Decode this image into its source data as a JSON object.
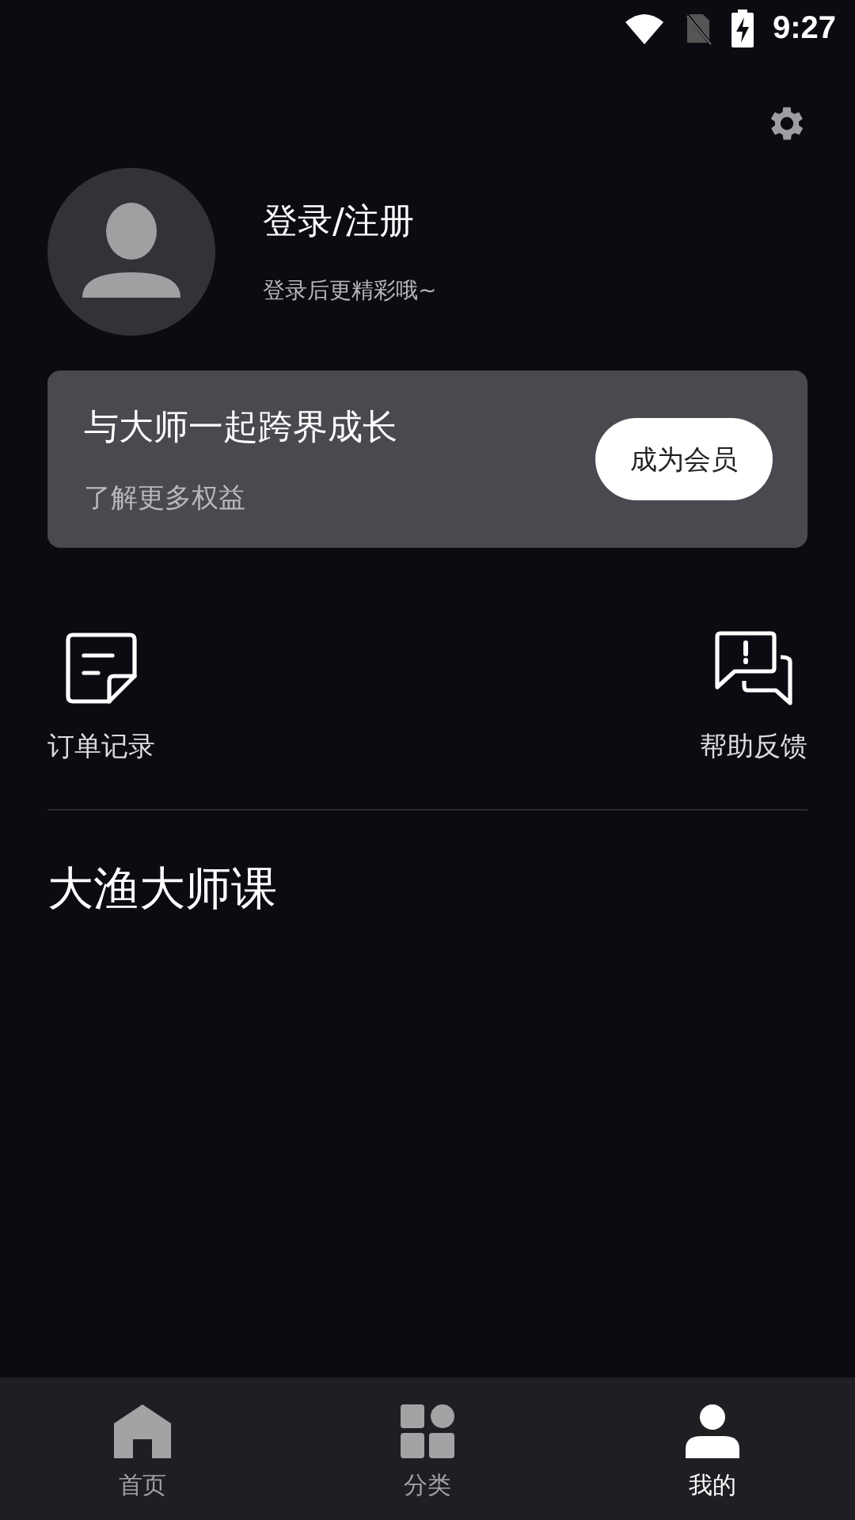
{
  "status_bar": {
    "time": "9:27"
  },
  "profile": {
    "name": "登录/注册",
    "subtitle": "登录后更精彩哦~"
  },
  "membership": {
    "title": "与大师一起跨界成长",
    "subtitle": "了解更多权益",
    "button": "成为会员"
  },
  "shortcuts": [
    {
      "kind": "orders",
      "label": "订单记录"
    },
    {
      "kind": "feedback",
      "label": "帮助反馈"
    }
  ],
  "section_title": "大渔大师课",
  "nav": [
    {
      "kind": "home",
      "label": "首页",
      "selected": false
    },
    {
      "kind": "category",
      "label": "分类",
      "selected": false
    },
    {
      "kind": "me",
      "label": "我的",
      "selected": true
    }
  ]
}
